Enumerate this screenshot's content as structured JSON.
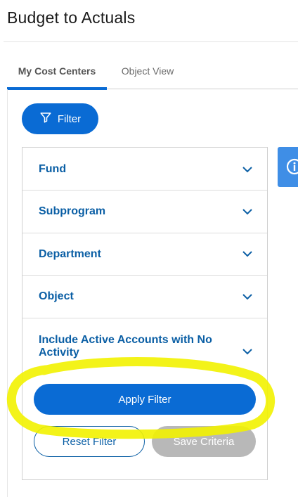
{
  "page": {
    "title": "Budget to Actuals"
  },
  "tabs": [
    {
      "label": "My Cost Centers",
      "active": true
    },
    {
      "label": "Object View",
      "active": false
    }
  ],
  "filter_button": {
    "label": "Filter",
    "icon": "filter-icon"
  },
  "accordion": [
    {
      "label": "Fund",
      "icon": "chevron-down-icon"
    },
    {
      "label": "Subprogram",
      "icon": "chevron-down-icon"
    },
    {
      "label": "Department",
      "icon": "chevron-down-icon"
    },
    {
      "label": "Object",
      "icon": "chevron-down-icon"
    },
    {
      "label": "Include Active Accounts with No Activity",
      "icon": "chevron-down-icon"
    }
  ],
  "info_tab": {
    "icon": "info-icon"
  },
  "actions": {
    "apply_label": "Apply Filter",
    "reset_label": "Reset Filter",
    "save_label": "Save Criteria"
  },
  "colors": {
    "primary": "#0a6bd4",
    "label_blue": "#0b5fa5",
    "disabled": "#b8b8b8",
    "highlighter": "#f2f200"
  }
}
